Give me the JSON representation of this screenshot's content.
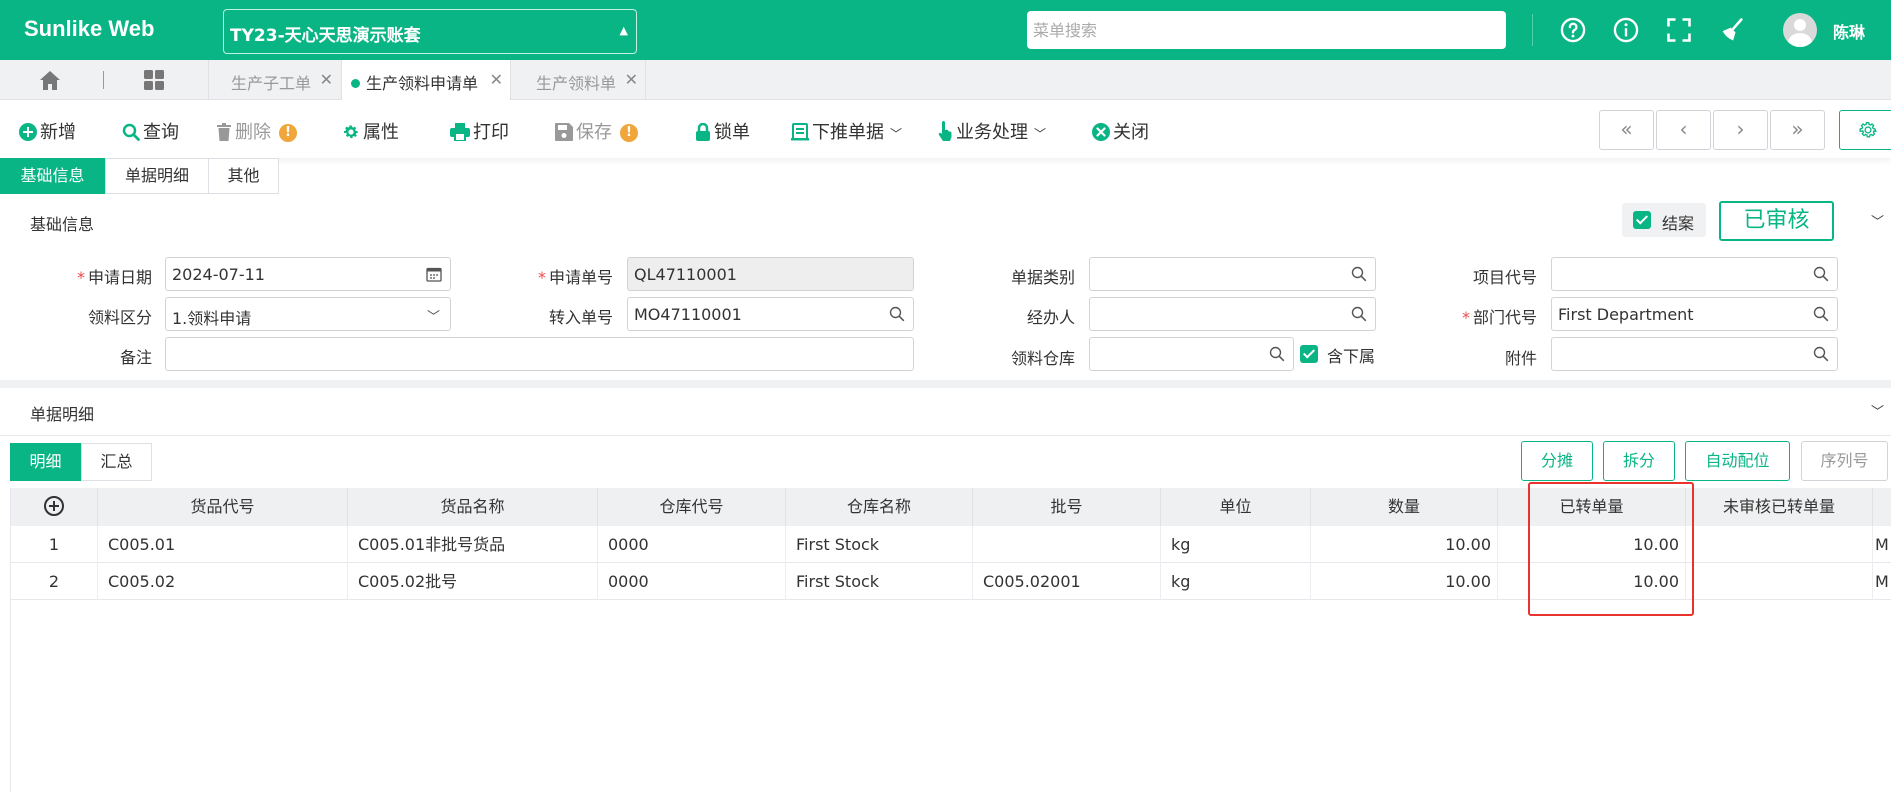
{
  "header": {
    "brand": "Sunlike Web",
    "account": "TY23-天心天思演示账套",
    "search_placeholder": "菜单搜索",
    "icons": [
      "help-icon",
      "info-icon",
      "fullscreen-icon",
      "broom-icon"
    ],
    "user_name": "陈琳"
  },
  "page_tabs": [
    {
      "label": "生产子工单",
      "active": false
    },
    {
      "label": "生产领料申请单",
      "active": true
    },
    {
      "label": "生产领料单",
      "active": false
    }
  ],
  "toolbar": {
    "new": "新增",
    "query": "查询",
    "delete": "删除",
    "properties": "属性",
    "print": "打印",
    "save": "保存",
    "lock": "锁单",
    "push_down": "下推单据",
    "business": "业务处理",
    "close": "关闭",
    "warn_mark": "!"
  },
  "section_tabs": [
    "基础信息",
    "单据明细",
    "其他"
  ],
  "basic_info": {
    "title": "基础信息",
    "closed_label": "结案",
    "status_stamp": "已审核",
    "fields": {
      "apply_date": {
        "label": "申请日期",
        "value": "2024-07-11"
      },
      "apply_no": {
        "label": "申请单号",
        "value": "QL47110001"
      },
      "doc_type": {
        "label": "单据类别",
        "value": ""
      },
      "project_code": {
        "label": "项目代号",
        "value": ""
      },
      "pick_type": {
        "label": "领料区分",
        "value": "1.领料申请"
      },
      "source_no": {
        "label": "转入单号",
        "value": "MO47110001"
      },
      "handler": {
        "label": "经办人",
        "value": ""
      },
      "dept_code": {
        "label": "部门代号",
        "value": "First Department"
      },
      "remark": {
        "label": "备注",
        "value": ""
      },
      "warehouse": {
        "label": "领料仓库",
        "value": ""
      },
      "include_sub": "含下属",
      "attachment": {
        "label": "附件",
        "value": ""
      }
    }
  },
  "detail": {
    "title": "单据明细",
    "sub_tabs": [
      "明细",
      "汇总"
    ],
    "actions": [
      "分摊",
      "拆分",
      "自动配位",
      "序列号"
    ],
    "columns": [
      "货品代号",
      "货品名称",
      "仓库代号",
      "仓库名称",
      "批号",
      "单位",
      "数量",
      "已转单量",
      "未审核已转单量"
    ],
    "rows": [
      {
        "idx": "1",
        "code": "C005.01",
        "name": "C005.01非批号货品",
        "wh_code": "0000",
        "wh_name": "First Stock",
        "batch": "",
        "unit": "kg",
        "qty": "10.00",
        "transferred": "10.00",
        "unaudited": "",
        "extra": "M"
      },
      {
        "idx": "2",
        "code": "C005.02",
        "name": "C005.02批号",
        "wh_code": "0000",
        "wh_name": "First Stock",
        "batch": "C005.02001",
        "unit": "kg",
        "qty": "10.00",
        "transferred": "10.00",
        "unaudited": "",
        "extra": "M"
      }
    ]
  },
  "colors": {
    "accent": "#0ab585",
    "highlight": "#e8332e",
    "warning": "#f0a63b"
  }
}
